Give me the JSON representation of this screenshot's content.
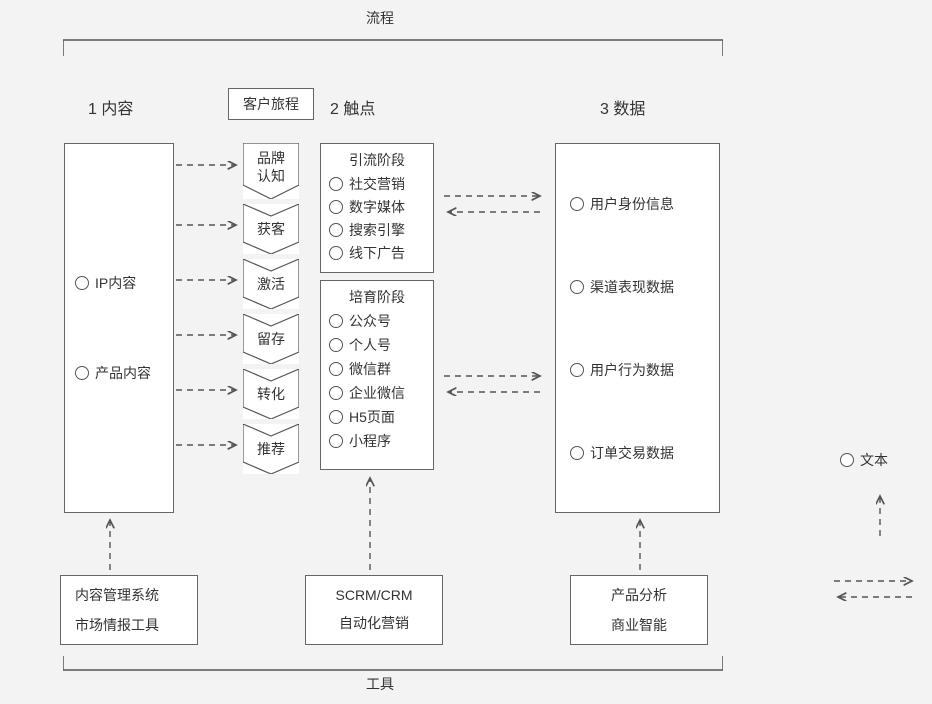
{
  "top_bracket_label": "流程",
  "bottom_bracket_label": "工具",
  "journey_box_label": "客户旅程",
  "sections": {
    "content": {
      "num": "1",
      "title": "内容"
    },
    "touch": {
      "num": "2",
      "title": "触点"
    },
    "data": {
      "num": "3",
      "title": "数据"
    }
  },
  "content_box": {
    "items": [
      "IP内容",
      "产品内容"
    ]
  },
  "journey_steps": [
    "品牌\n认知",
    "获客",
    "激活",
    "留存",
    "转化",
    "推荐"
  ],
  "touch_lead": {
    "title": "引流阶段",
    "items": [
      "社交营销",
      "数字媒体",
      "搜索引擎",
      "线下广告"
    ]
  },
  "touch_nurture": {
    "title": "培育阶段",
    "items": [
      "公众号",
      "个人号",
      "微信群",
      "企业微信",
      "H5页面",
      "小程序"
    ]
  },
  "data_box": {
    "items": [
      "用户身份信息",
      "渠道表现数据",
      "用户行为数据",
      "订单交易数据"
    ]
  },
  "tools": {
    "content": [
      "内容管理系统",
      "市场情报工具"
    ],
    "touch": [
      "SCRM/CRM",
      "自动化营销"
    ],
    "data": [
      "产品分析",
      "商业智能"
    ]
  },
  "legend": {
    "label": "文本"
  }
}
